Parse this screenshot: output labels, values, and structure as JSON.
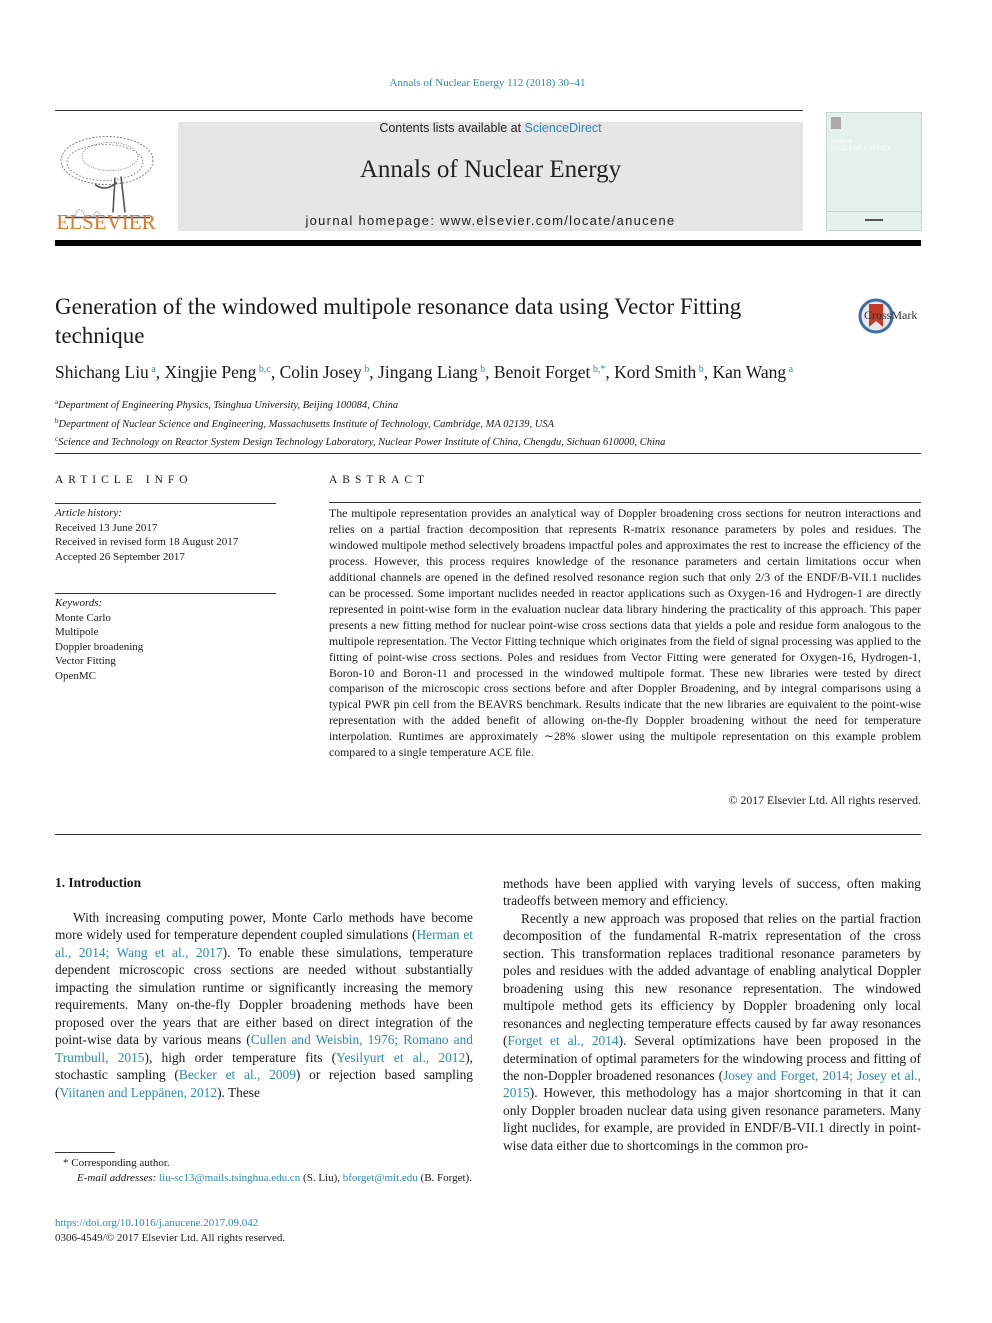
{
  "header": {
    "journal_ref": "Annals of Nuclear Energy 112 (2018) 30–41",
    "contents_prefix": "Contents lists available at ",
    "contents_link": "ScienceDirect",
    "journal_title": "Annals of Nuclear Energy",
    "homepage": "journal homepage: www.elsevier.com/locate/anucene",
    "publisher": "ELSEVIER",
    "cover_line1": "annals of",
    "cover_line2": "NUCLEAR ENERGY",
    "crossmark": "CrossMark",
    "colors": {
      "link": "#2a8ab8",
      "elsevier": "#e87722",
      "masthead_bg": "#e6e6e6"
    }
  },
  "article": {
    "title": "Generation of the windowed multipole resonance data using Vector Fitting technique",
    "authors": [
      {
        "name": "Shichang Liu",
        "sup": "a",
        "sep": ", "
      },
      {
        "name": "Xingjie Peng",
        "sup": "b,c",
        "sep": ", "
      },
      {
        "name": "Colin Josey",
        "sup": "b",
        "sep": ", "
      },
      {
        "name": "Jingang Liang",
        "sup": "b",
        "sep": ", "
      },
      {
        "name": "Benoit Forget",
        "sup": "b,*",
        "sep": ", "
      },
      {
        "name": "Kord Smith",
        "sup": "b",
        "sep": ", "
      },
      {
        "name": "Kan Wang",
        "sup": "a",
        "sep": ""
      }
    ],
    "affiliations": [
      {
        "sup": "a",
        "text": "Department of Engineering Physics, Tsinghua University, Beijing 100084, China"
      },
      {
        "sup": "b",
        "text": "Department of Nuclear Science and Engineering, Massachusetts Institute of Technology, Cambridge, MA 02139, USA"
      },
      {
        "sup": "c",
        "text": "Science and Technology on Reactor System Design Technology Laboratory, Nuclear Power Institute of China, Chengdu, Sichuan 610000, China"
      }
    ]
  },
  "article_info": {
    "heading": "ARTICLE INFO",
    "history_label": "Article history:",
    "history": [
      "Received 13 June 2017",
      "Received in revised form 18 August 2017",
      "Accepted 26 September 2017"
    ],
    "keywords_label": "Keywords:",
    "keywords": [
      "Monte Carlo",
      "Multipole",
      "Doppler broadening",
      "Vector Fitting",
      "OpenMC"
    ]
  },
  "abstract": {
    "heading": "ABSTRACT",
    "text": "The multipole representation provides an analytical way of Doppler broadening cross sections for neutron interactions and relies on a partial fraction decomposition that represents R-matrix resonance parameters by poles and residues. The windowed multipole method selectively broadens impactful poles and approximates the rest to increase the efficiency of the process. However, this process requires knowledge of the resonance parameters and certain limitations occur when additional channels are opened in the defined resolved resonance region such that only 2/3 of the ENDF/B-VII.1 nuclides can be processed. Some important nuclides needed in reactor applications such as Oxygen-16 and Hydrogen-1 are directly represented in point-wise form in the evaluation nuclear data library hindering the practicality of this approach. This paper presents a new fitting method for nuclear point-wise cross sections data that yields a pole and residue form analogous to the multipole representation. The Vector Fitting technique which originates from the field of signal processing was applied to the fitting of point-wise cross sections. Poles and residues from Vector Fitting were generated for Oxygen-16, Hydrogen-1, Boron-10 and Boron-11 and processed in the windowed multipole format. These new libraries were tested by direct comparison of the microscopic cross sections before and after Doppler Broadening, and by integral comparisons using a typical PWR pin cell from the BEAVRS benchmark. Results indicate that the new libraries are equivalent to the point-wise representation with the added benefit of allowing on-the-fly Doppler broadening without the need for temperature interpolation. Runtimes are approximately ∼28% slower using the multipole representation on this example problem compared to a single temperature ACE file.",
    "copyright": "© 2017 Elsevier Ltd. All rights reserved."
  },
  "body": {
    "section_heading": "1. Introduction",
    "left_para": [
      {
        "t": "With increasing computing power, Monte Carlo methods have become more widely used for temperature dependent coupled simulations ("
      },
      {
        "l": "Herman et al., 2014; Wang et al., 2017"
      },
      {
        "t": "). To enable these simulations, temperature dependent microscopic cross sections are needed without substantially impacting the simulation runtime or significantly increasing the memory requirements. Many on-the-fly Doppler broadening methods have been proposed over the years that are either based on direct integration of the point-wise data by various means ("
      },
      {
        "l": "Cullen and Weisbin, 1976; Romano and Trumbull, 2015"
      },
      {
        "t": "), high order temperature fits ("
      },
      {
        "l": "Yesilyurt et al., 2012"
      },
      {
        "t": "), stochastic sampling ("
      },
      {
        "l": "Becker et al., 2009"
      },
      {
        "t": ") or rejection based sampling ("
      },
      {
        "l": "Viitanen and Leppänen, 2012"
      },
      {
        "t": "). These"
      }
    ],
    "right_para1": "methods have been applied with varying levels of success, often making tradeoffs between memory and efficiency.",
    "right_para2": [
      {
        "t": "Recently a new approach was proposed that relies on the partial fraction decomposition of the fundamental R-matrix representation of the cross section. This transformation replaces traditional resonance parameters by poles and residues with the added advantage of enabling analytical Doppler broadening using this new resonance representation. The windowed multipole method gets its efficiency by Doppler broadening only local resonances and neglecting temperature effects caused by far away resonances ("
      },
      {
        "l": "Forget et al., 2014"
      },
      {
        "t": "). Several optimizations have been proposed in the determination of optimal parameters for the windowing process and fitting of the non-Doppler broadened resonances ("
      },
      {
        "l": "Josey and Forget, 2014; Josey et al., 2015"
      },
      {
        "t": "). However, this methodology has a major shortcoming in that it can only Doppler broaden nuclear data using given resonance parameters. Many light nuclides, for example, are provided in ENDF/B-VII.1 directly in point-wise data either due to shortcomings in the common pro-"
      }
    ]
  },
  "footnotes": {
    "corresponding": "* Corresponding author.",
    "email_label": "E-mail addresses:",
    "email1": "liu-sc13@mails.tsinghua.edu.cn",
    "email1_owner": " (S. Liu), ",
    "email2": "bforget@mit.edu",
    "email2_owner": " (B. Forget).",
    "doi": "https://doi.org/10.1016/j.anucene.2017.09.042",
    "issn": "0306-4549/© 2017 Elsevier Ltd. All rights reserved."
  }
}
